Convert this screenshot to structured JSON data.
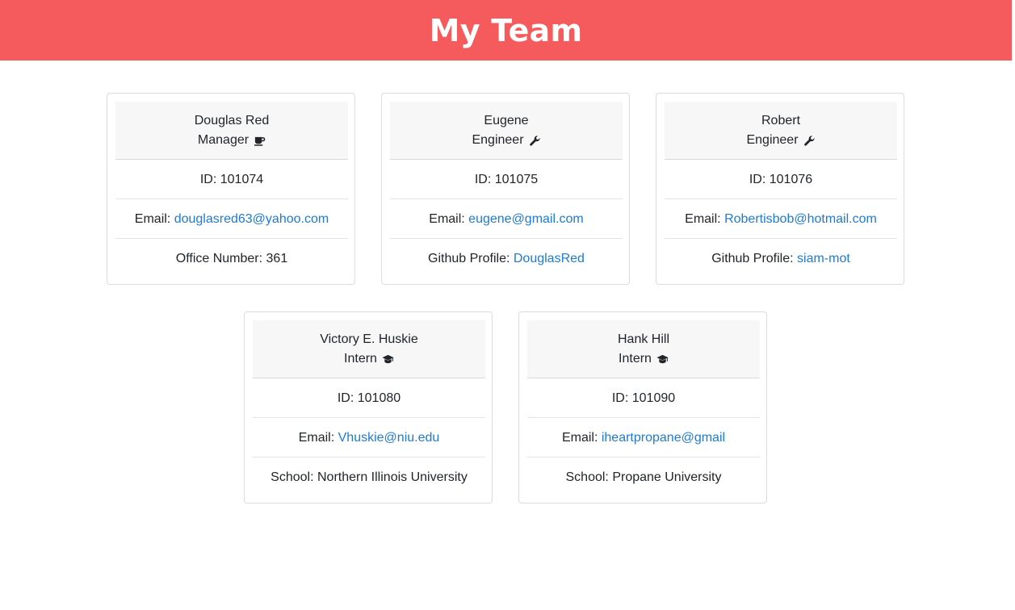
{
  "header": {
    "title": "My Team"
  },
  "cards": [
    {
      "name": "Douglas Red",
      "role": "Manager",
      "icon": "coffee-mug-icon",
      "id_label": "ID: 101074",
      "email_label": "Email: ",
      "email": "douglasred63@yahoo.com",
      "extra_label": "Office Number: 361",
      "extra_link": ""
    },
    {
      "name": "Eugene",
      "role": "Engineer",
      "icon": "wrench-icon",
      "id_label": "ID: 101075",
      "email_label": "Email: ",
      "email": "eugene@gmail.com",
      "extra_label": "Github Profile: ",
      "extra_link": "DouglasRed"
    },
    {
      "name": "Robert",
      "role": "Engineer",
      "icon": "wrench-icon",
      "id_label": "ID: 101076",
      "email_label": "Email: ",
      "email": "Robertisbob@hotmail.com",
      "extra_label": "Github Profile: ",
      "extra_link": "siam-mot"
    },
    {
      "name": "Victory E. Huskie",
      "role": "Intern",
      "icon": "graduation-cap-icon",
      "id_label": "ID: 101080",
      "email_label": "Email: ",
      "email": "Vhuskie@niu.edu",
      "extra_label": "School: Northern Illinois University",
      "extra_link": ""
    },
    {
      "name": "Hank Hill",
      "role": "Intern",
      "icon": "graduation-cap-icon",
      "id_label": "ID: 101090",
      "email_label": "Email: ",
      "email": "iheartpropane@gmail",
      "extra_label": "School: Propane University",
      "extra_link": ""
    }
  ],
  "colors": {
    "header_bg": "#f55a5c",
    "link": "#1f7ad2",
    "card_header_bg": "#f7f7f7"
  }
}
